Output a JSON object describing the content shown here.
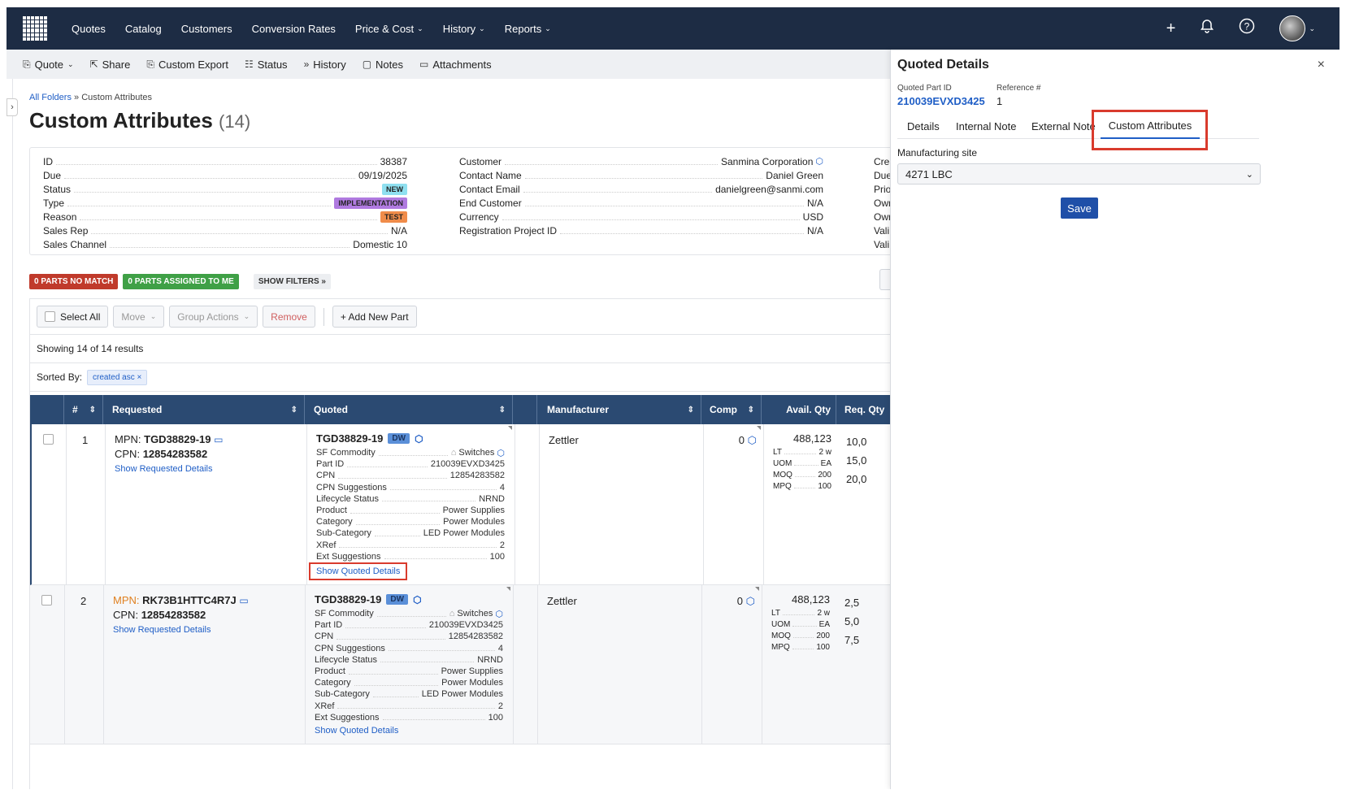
{
  "nav": {
    "items": [
      {
        "label": "Quotes",
        "chevron": false
      },
      {
        "label": "Catalog",
        "chevron": false
      },
      {
        "label": "Customers",
        "chevron": false
      },
      {
        "label": "Conversion Rates",
        "chevron": false
      },
      {
        "label": "Price & Cost",
        "chevron": true
      },
      {
        "label": "History",
        "chevron": true
      },
      {
        "label": "Reports",
        "chevron": true
      }
    ]
  },
  "toolbar": {
    "quote": "Quote",
    "share": "Share",
    "custom_export": "Custom Export",
    "status": "Status",
    "history": "History",
    "notes": "Notes",
    "attachments": "Attachments"
  },
  "breadcrumb": {
    "root": "All Folders",
    "sep": " » ",
    "current": "Custom Attributes"
  },
  "page": {
    "title": "Custom Attributes",
    "count": "(14)"
  },
  "info": {
    "left": [
      {
        "k": "ID",
        "v": "38387"
      },
      {
        "k": "Due",
        "v": "09/19/2025"
      },
      {
        "k": "Status",
        "v": "NEW"
      },
      {
        "k": "Type",
        "v": "IMPLEMENTATION"
      },
      {
        "k": "Reason",
        "v": "TEST"
      },
      {
        "k": "Sales Rep",
        "v": "N/A"
      },
      {
        "k": "Sales Channel",
        "v": "Domestic 10"
      }
    ],
    "middle": [
      {
        "k": "Customer",
        "v": "Sanmina Corporation"
      },
      {
        "k": "Contact Name",
        "v": "Daniel Green"
      },
      {
        "k": "Contact Email",
        "v": "danielgreen@sanmi.com"
      },
      {
        "k": "End Customer",
        "v": "N/A"
      },
      {
        "k": "Currency",
        "v": "USD"
      },
      {
        "k": "Registration Project ID",
        "v": "N/A"
      }
    ],
    "right_cut": [
      "Crea",
      "Due",
      "Prio",
      "Own",
      "Own",
      "Vali",
      "Vali"
    ]
  },
  "chips": {
    "no_match": "0 PARTS NO MATCH",
    "assigned": "0 PARTS ASSIGNED TO ME",
    "filters": "SHOW FILTERS »"
  },
  "actions": {
    "select_all": "Select All",
    "move": "Move",
    "group_actions": "Group Actions",
    "remove": "Remove",
    "add_part": "+ Add New Part"
  },
  "results": {
    "showing": "Showing 14 of 14 results",
    "sorted_by": "Sorted By:",
    "sort_tag": "created asc"
  },
  "table": {
    "headers": {
      "num": "#",
      "requested": "Requested",
      "quoted": "Quoted",
      "manufacturer": "Manufacturer",
      "comp": "Comp",
      "avail": "Avail. Qty",
      "req": "Req. Qty"
    },
    "rows": [
      {
        "num": "1",
        "mpn_label": "MPN:",
        "mpn": "TGD38829-19",
        "cpn_label": "CPN:",
        "cpn": "12854283582",
        "req_link": "Show Requested Details",
        "quoted_part": "TGD38829-19",
        "dw": "DW",
        "quoted_fields": [
          {
            "k": "SF Commodity",
            "v": "Switches"
          },
          {
            "k": "Part ID",
            "v": "210039EVXD3425"
          },
          {
            "k": "CPN",
            "v": "12854283582"
          },
          {
            "k": "CPN Suggestions",
            "v": "4"
          },
          {
            "k": "Lifecycle Status",
            "v": "NRND"
          },
          {
            "k": "Product",
            "v": "Power Supplies"
          },
          {
            "k": "Category",
            "v": "Power Modules"
          },
          {
            "k": "Sub-Category",
            "v": "LED Power Modules"
          },
          {
            "k": "XRef",
            "v": "2"
          },
          {
            "k": "Ext Suggestions",
            "v": "100"
          }
        ],
        "quoted_link": "Show Quoted Details",
        "manufacturer": "Zettler",
        "comp": "0",
        "avail_total": "488,123",
        "avail_fields": [
          {
            "k": "LT",
            "v": "2 w"
          },
          {
            "k": "UOM",
            "v": "EA"
          },
          {
            "k": "MOQ",
            "v": "200"
          },
          {
            "k": "MPQ",
            "v": "100"
          }
        ],
        "req_qty": [
          "10,0",
          "15,0",
          "20,0"
        ]
      },
      {
        "num": "2",
        "mpn_label": "MPN:",
        "mpn": "RK73B1HTTC4R7J",
        "cpn_label": "CPN:",
        "cpn": "12854283582",
        "req_link": "Show Requested Details",
        "quoted_part": "TGD38829-19",
        "dw": "DW",
        "quoted_fields": [
          {
            "k": "SF Commodity",
            "v": "Switches"
          },
          {
            "k": "Part ID",
            "v": "210039EVXD3425"
          },
          {
            "k": "CPN",
            "v": "12854283582"
          },
          {
            "k": "CPN Suggestions",
            "v": "4"
          },
          {
            "k": "Lifecycle Status",
            "v": "NRND"
          },
          {
            "k": "Product",
            "v": "Power Supplies"
          },
          {
            "k": "Category",
            "v": "Power Modules"
          },
          {
            "k": "Sub-Category",
            "v": "LED Power Modules"
          },
          {
            "k": "XRef",
            "v": "2"
          },
          {
            "k": "Ext Suggestions",
            "v": "100"
          }
        ],
        "quoted_link": "Show Quoted Details",
        "manufacturer": "Zettler",
        "comp": "0",
        "avail_total": "488,123",
        "avail_fields": [
          {
            "k": "LT",
            "v": "2 w"
          },
          {
            "k": "UOM",
            "v": "EA"
          },
          {
            "k": "MOQ",
            "v": "200"
          },
          {
            "k": "MPQ",
            "v": "100"
          }
        ],
        "req_qty": [
          "2,5",
          "5,0",
          "7,5"
        ]
      }
    ]
  },
  "side": {
    "title": "Quoted Details",
    "close": "×",
    "part_id_label": "Quoted Part ID",
    "part_id": "210039EVXD3425",
    "ref_label": "Reference #",
    "ref": "1",
    "tabs": [
      "Details",
      "Internal Note",
      "External Note",
      "Custom Attributes"
    ],
    "field_label": "Manufacturing site",
    "field_value": "4271 LBC",
    "save": "Save"
  },
  "colors": {
    "nav_bg": "#1d2c44",
    "table_head": "#2b4a72",
    "accent": "#1f5ec6",
    "highlight": "#d93b2d"
  }
}
